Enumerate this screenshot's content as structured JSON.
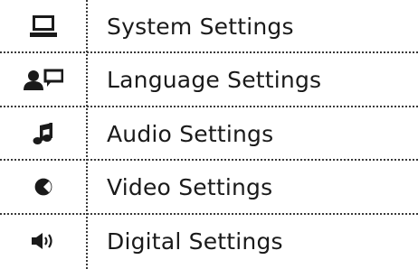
{
  "menu": {
    "items": [
      {
        "label": "System Settings",
        "icon": "monitor-icon"
      },
      {
        "label": "Language Settings",
        "icon": "person-speech-icon"
      },
      {
        "label": "Audio Settings",
        "icon": "music-note-icon"
      },
      {
        "label": "Video Settings",
        "icon": "video-disc-icon"
      },
      {
        "label": "Digital Settings",
        "icon": "speaker-icon"
      }
    ]
  },
  "colors": {
    "text": "#1a1a1a",
    "divider": "#3a3a3a",
    "background": "#ffffff"
  }
}
